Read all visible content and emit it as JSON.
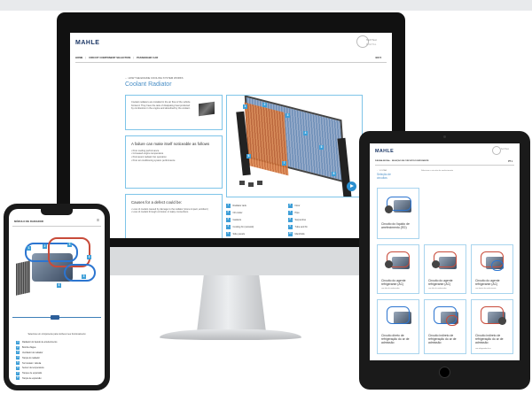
{
  "monitor": {
    "logo": "MAHLE",
    "brand": "TechTest",
    "brand_sub": "DIGITAL",
    "nav": [
      "HOME",
      "CIRCUIT COMPONENT SELECTION",
      "PASSENGER CAR"
    ],
    "lang": "EN",
    "back_link": "← HOW THE ENGINE COOLING SYSTEM WORKS",
    "page_title": "Coolant Radiator",
    "intro_text": "Coolant radiators are installed in the air flow of the vehicle frontend. They have the task of dissipating heat produced by combustion in the engine and absorbed by the coolant.",
    "failure_title": "A failure can make itself noticeable as follows",
    "failure_items": [
      "Poor cooling performance",
      "Increased engine temperature",
      "Permanent radiator fan operation",
      "Poor air conditioning system performance"
    ],
    "causes_title": "Causes for a defect could be:",
    "causes_items": [
      "Loss of coolant caused by damage to the radiator (stone impact, accident)",
      "Loss of coolant through corrosion or leaky connections"
    ],
    "legend": [
      {
        "num": "1",
        "label": "Radiator tank"
      },
      {
        "num": "2",
        "label": "Oil cooler"
      },
      {
        "num": "3",
        "label": "Gaskets"
      },
      {
        "num": "4",
        "label": "Cooling fin (network)"
      },
      {
        "num": "5",
        "label": "Side panels"
      },
      {
        "num": "6",
        "label": "Floor"
      },
      {
        "num": "7",
        "label": "Pipe"
      },
      {
        "num": "8",
        "label": "Serpentine"
      },
      {
        "num": "9",
        "label": "Tube and fin"
      },
      {
        "num": "10",
        "label": "Manifolds"
      }
    ]
  },
  "phone": {
    "title": "MÓDULO DE RADIADOR",
    "menu_icon": "hamburger-icon",
    "prompt": "Selecione um componente para conhecer seu funcionamento",
    "items": [
      {
        "num": "1",
        "label": "Radiador do líquido de arrefecimento"
      },
      {
        "num": "2",
        "label": "Bomba d'água"
      },
      {
        "num": "3",
        "label": "Ventilador do radiador"
      },
      {
        "num": "4",
        "label": "Tampa do radiador"
      },
      {
        "num": "5",
        "label": "Termostato / válvula"
      },
      {
        "num": "6",
        "label": "Sensor de temperatura"
      },
      {
        "num": "7",
        "label": "Tanque de expansão"
      },
      {
        "num": "8",
        "label": "Tampa de expansão"
      }
    ]
  },
  "tablet": {
    "logo": "MAHLE",
    "brand": "TechTest",
    "nav": "PÁGINA INICIAL  ·  SELEÇÃO DE CIRCUITO/COMPONENTE",
    "lang": "PT",
    "back_link": "← VOLTAR",
    "page_title": "Seleção de circuitos",
    "sub_text": "Selecione o circuito de arrefecimento",
    "cards": [
      {
        "label": "Circuito do líquido de arrefecimento (ED)",
        "small": ""
      },
      {
        "label": "Circuito do agente refrigerante (AC)",
        "small": "com óleo de condensador"
      },
      {
        "label": "Circuito do agente refrigerante (AC)",
        "small": "com óleo de condensador"
      },
      {
        "label": "Circuito do agente refrigerante (AC)",
        "small": "com bateria de arrefecimento"
      },
      {
        "label": "Circuito direto de refrigeração do ar de admissão",
        "small": ""
      },
      {
        "label": "Circuito indireto de refrigeração do ar de admissão",
        "small": ""
      },
      {
        "label": "Circuito indireto de refrigeração do ar de admissão",
        "small": "com refrigerador de ar"
      }
    ]
  }
}
